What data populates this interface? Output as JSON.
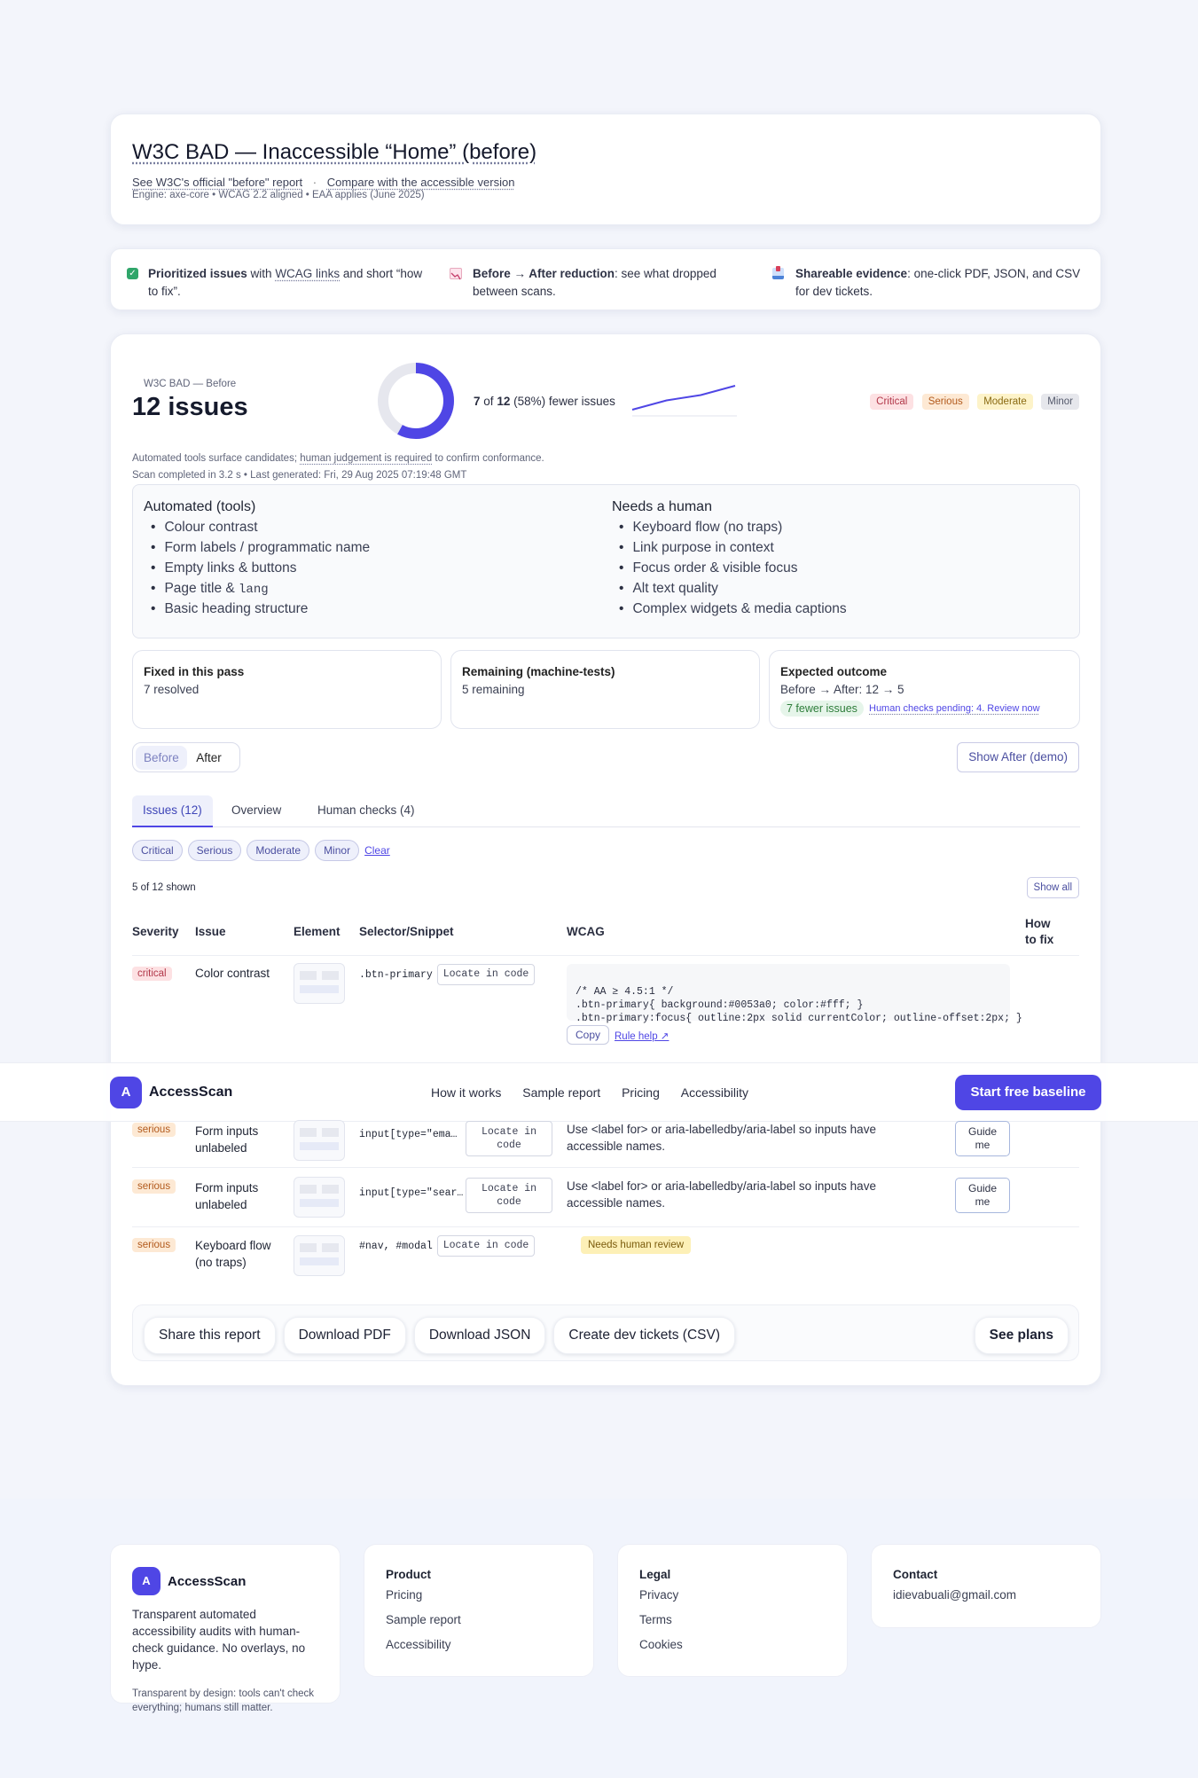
{
  "report": {
    "title": "W3C BAD — Inaccessible “Home” (before)",
    "link_before": "See W3C's official \"before\" report",
    "separator": "·",
    "link_compare": "Compare with the accessible version",
    "engine": "Engine: axe-core • WCAG 2.2 aligned • EAA applies (June 2025)"
  },
  "features": [
    {
      "icon": "checkbox-icon",
      "bold": "Prioritized issues",
      "pre": " with ",
      "link": "WCAG links",
      "text": " and short “how to fix”."
    },
    {
      "icon": "chart-down-icon",
      "bold": "Before → After reduction",
      "text": ": see what dropped between scans."
    },
    {
      "icon": "inbox-tray-icon",
      "bold": "Shareable evidence",
      "text": ": one-click PDF, JSON, and CSV for dev tickets."
    }
  ],
  "summary": {
    "label": "W3C BAD — Before",
    "issues": "12 issues",
    "fewer_a": "7",
    "fewer_of": "of",
    "fewer_b": "12",
    "fewer_pct": "(58%) fewer issues",
    "donut_fraction": 0.58,
    "trend": [
      0.1,
      0.45,
      0.65,
      1.0
    ],
    "severity_chips": [
      "Critical",
      "Serious",
      "Moderate",
      "Minor"
    ],
    "note_pre": "Automated tools surface candidates; ",
    "note_link": "human judgement is required",
    "note_post": " to confirm conformance.",
    "scan": "Scan completed in 3.2 s • Last generated: Fri, 29 Aug 2025 07:19:48 GMT"
  },
  "automated": {
    "title": "Automated (tools)",
    "items": [
      "Colour contrast",
      "Form labels / programmatic name",
      "Empty links & buttons",
      "Page title & ",
      "Basic heading structure"
    ],
    "item4_code": "lang"
  },
  "human": {
    "title": "Needs a human",
    "items": [
      "Keyboard flow (no traps)",
      "Link purpose in context",
      "Focus order & visible focus",
      "Alt text quality",
      "Complex widgets & media captions"
    ]
  },
  "stats": {
    "fixed_title": "Fixed in this pass",
    "fixed_value": "7 resolved",
    "remaining_title": "Remaining (machine-tests)",
    "remaining_value": "5 remaining",
    "expected_title": "Expected outcome",
    "expected_value": "Before → After: 12 → 5",
    "expected_badge": "7 fewer issues",
    "expected_link": "Human checks pending: 4. Review now"
  },
  "toggle": {
    "before": "Before",
    "after": "After",
    "show_after": "Show After (demo)"
  },
  "tabs": [
    "Issues (12)",
    "Overview",
    "Human checks (4)"
  ],
  "filters": [
    "Critical",
    "Serious",
    "Moderate",
    "Minor"
  ],
  "filter_clear": "Clear",
  "shown": "5 of 12 shown",
  "show_all": "Show all",
  "columns": {
    "severity": "Severity",
    "issue": "Issue",
    "element": "Element",
    "selector": "Selector/Snippet",
    "wcag": "WCAG",
    "howfix_1": "How",
    "howfix_2": "to fix"
  },
  "rows": [
    {
      "severity": "critical",
      "issue": "Color contrast",
      "selector": ".btn-primary",
      "locate": "Locate in code",
      "code": [
        "/* AA ≥ 4.5:1 */",
        ".btn-primary{ background:#0053a0; color:#fff; }",
        ".btn-primary:focus{ outline:2px solid currentColor; outline-offset:2px; }"
      ],
      "copy": "Copy",
      "rule_help": "Rule help ↗"
    },
    {
      "severity": "serious",
      "issue_1": "Form inputs",
      "issue_2": "unlabeled",
      "selector": "input[type=\"ema…",
      "locate_1": "Locate in",
      "locate_2": "code",
      "fix_1": "Use <label for> or aria-labelledby/aria-label so inputs have",
      "fix_2": "accessible names.",
      "guide_1": "Guide",
      "guide_2": "me"
    },
    {
      "severity": "serious",
      "issue_1": "Form inputs",
      "issue_2": "unlabeled",
      "selector": "input[type=\"sear…",
      "locate_1": "Locate in",
      "locate_2": "code",
      "fix_1": "Use <label for> or aria-labelledby/aria-label so inputs have",
      "fix_2": "accessible names.",
      "guide_1": "Guide",
      "guide_2": "me"
    },
    {
      "severity": "serious",
      "issue_1": "Keyboard flow",
      "issue_2": "(no traps)",
      "selector": "#nav, #modal",
      "locate": "Locate in code",
      "review": "Needs human review"
    }
  ],
  "actions": [
    "Share this report",
    "Download PDF",
    "Download JSON",
    "Create dev tickets (CSV)"
  ],
  "see_plans": "See plans",
  "nav": {
    "logo_letter": "A",
    "brand": "AccessScan",
    "links": [
      "How it works",
      "Sample report",
      "Pricing",
      "Accessibility"
    ],
    "cta": "Start free baseline"
  },
  "footer": {
    "logo_letter": "A",
    "brand": "AccessScan",
    "tagline": "Transparent automated accessibility audits with human-check guidance. No overlays, no hype.",
    "note": "Transparent by design: tools can't check everything; humans still matter.",
    "product_title": "Product",
    "product_links": [
      "Pricing",
      "Sample report",
      "Accessibility"
    ],
    "legal_title": "Legal",
    "legal_links": [
      "Privacy",
      "Terms",
      "Cookies"
    ],
    "contact_title": "Contact",
    "contact_email": "idievabuali@gmail.com"
  },
  "colors": {
    "accent": "#4f46e5",
    "critical": "#b2384a",
    "serious": "#b25a1d",
    "success": "#2e7d3a"
  }
}
